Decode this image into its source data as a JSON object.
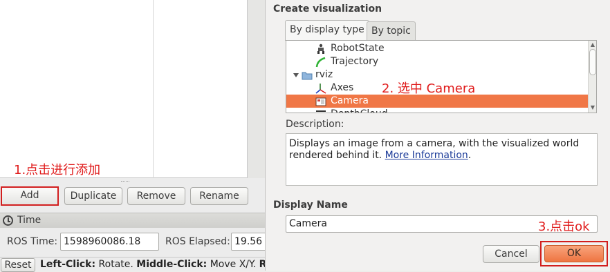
{
  "left_panel": {
    "annotation_step1": "1.点击进行添加",
    "buttons": {
      "add": "Add",
      "duplicate": "Duplicate",
      "remove": "Remove",
      "rename": "Rename"
    },
    "time_panel": {
      "title": "Time",
      "ros_time_label": "ROS Time:",
      "ros_time_value": "1598960086.18",
      "ros_elapsed_label": "ROS Elapsed:",
      "ros_elapsed_value": "19.56"
    },
    "status_bar": {
      "reset_label": "Reset",
      "hint_left_click": "Left-Click:",
      "hint_left_action": " Rotate. ",
      "hint_middle_click": "Middle-Click:",
      "hint_middle_action": " Move X/Y. ",
      "hint_right_cut": "Rig"
    }
  },
  "dialog": {
    "title": "Create visualization",
    "tabs": [
      {
        "label": "By display type",
        "active": true
      },
      {
        "label": "By topic",
        "active": false
      }
    ],
    "items": [
      {
        "label": "RobotState",
        "icon": "robot-state-icon",
        "selected": false
      },
      {
        "label": "Trajectory",
        "icon": "trajectory-icon",
        "selected": false
      },
      {
        "label": "rviz",
        "icon": "folder-icon",
        "selected": false,
        "expanded": true
      },
      {
        "label": "Axes",
        "icon": "axes-icon",
        "selected": false
      },
      {
        "label": "Camera",
        "icon": "camera-icon",
        "selected": true
      },
      {
        "label": "DepthCloud",
        "icon": "depth-cloud-icon",
        "selected": false
      }
    ],
    "annotation_step2": "2. 选中 Camera",
    "description_label": "Description:",
    "description_text": "Displays an image from a camera, with the visualized world rendered behind it. ",
    "description_link": "More Information",
    "description_end": ".",
    "display_name_label": "Display Name",
    "display_name_value": "Camera",
    "annotation_step3": "3.点击ok",
    "cancel_label": "Cancel",
    "ok_label": "OK",
    "colors": {
      "selection": "#f07746",
      "annotation": "#e01b1b",
      "ok_button": "#ee7441"
    }
  }
}
